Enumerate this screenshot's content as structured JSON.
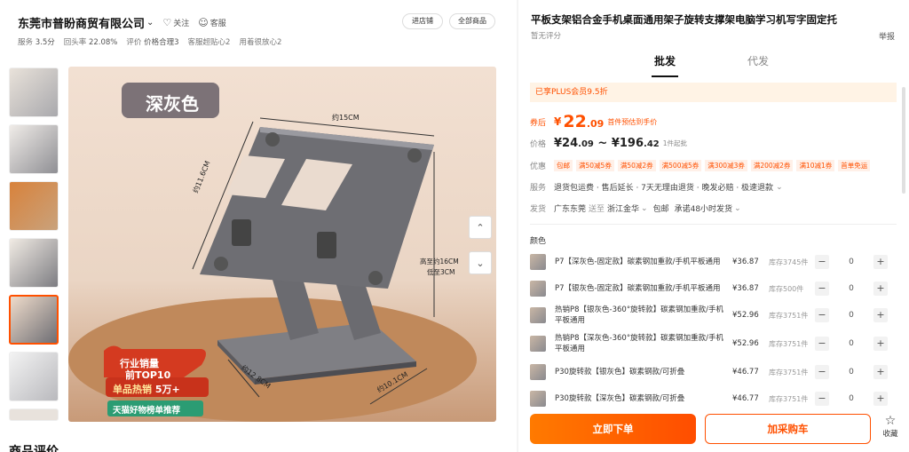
{
  "shop": {
    "name": "东莞市普盼商贸有限公司",
    "follow_label": "关注",
    "service_label": "客服",
    "enter_shop_label": "进店铺",
    "all_products_label": "全部商品",
    "stats": [
      {
        "label": "服务",
        "value": "3.5分"
      },
      {
        "label": "回头率",
        "value": "22.08%"
      },
      {
        "label": "评价",
        "value": "价格合理3"
      },
      {
        "label": "",
        "value": "客服超贴心2"
      },
      {
        "label": "",
        "value": "用着很放心2"
      }
    ]
  },
  "gallery": {
    "selected_index": 4,
    "main_image_labels": {
      "color_tag": "深灰色",
      "width": "约15CM",
      "depth": "约11.6CM",
      "height_max": "高至约16CM",
      "height_min": "低至3CM",
      "base_length": "约12.8CM",
      "base_width": "约10.1CM",
      "badge_line1": "行业销量",
      "badge_line2": "前TOP10",
      "hot_label": "单品热销",
      "hot_count": "5万+",
      "recommend": "天猫好物榜单推荐"
    }
  },
  "section_bottom_title": "商品评价",
  "product": {
    "title": "平板支架铝合金手机桌面通用架子旋转支撑架电脑学习机写字固定托",
    "rating": "暂无评分",
    "report_label": "举报",
    "tabs": [
      "批发",
      "代发"
    ],
    "plus_notice": "已享PLUS会员9.5折",
    "after_coupon_label": "券后",
    "after_price_int": "22",
    "after_price_dec": ".09",
    "after_price_note": "首件预估到手价",
    "price_label": "价格",
    "price_low_int": "24",
    "price_low_dec": ".09",
    "price_high_int": "196",
    "price_high_dec": ".42",
    "price_sep": "~",
    "min_order": "1件起批",
    "promo_label": "优惠",
    "coupons": [
      "包邮",
      "满50减5券",
      "满50减2券",
      "满500减5券",
      "满300减3券",
      "满200减2券",
      "满10减1券",
      "首单免运"
    ],
    "service_label": "服务",
    "services": "退货包运费 · 售后延长 · 7天无理由退货 · 晚发必赔 · 极速退款",
    "ship_label": "发货",
    "ship_from": "广东东莞",
    "ship_to_word": "送至",
    "ship_to": "浙江金华",
    "ship_free": "包邮",
    "ship_promise": "承诺48小时发货",
    "color_section": "颜色",
    "skus": [
      {
        "name": "P7【深灰色-固定款】碳素钢加重款/手机平板通用",
        "price": "¥36.87",
        "stock": "库存3745件",
        "qty": "0"
      },
      {
        "name": "P7【银灰色-固定款】碳素钢加重款/手机平板通用",
        "price": "¥36.87",
        "stock": "库存500件",
        "qty": "0"
      },
      {
        "name": "热销P8【银灰色-360°旋转款】碳素钢加重款/手机平板通用",
        "price": "¥52.96",
        "stock": "库存3751件",
        "qty": "0"
      },
      {
        "name": "热销P8【深灰色-360°旋转款】碳素钢加重款/手机平板通用",
        "price": "¥52.96",
        "stock": "库存3751件",
        "qty": "0"
      },
      {
        "name": "P30旋转款【银灰色】碳素钢款/可折叠",
        "price": "¥46.77",
        "stock": "库存3751件",
        "qty": "0"
      },
      {
        "name": "P30旋转款【深灰色】碳素钢款/可折叠",
        "price": "¥46.77",
        "stock": "库存3751件",
        "qty": "0"
      }
    ],
    "buy_now_label": "立即下单",
    "add_cart_label": "加采购车",
    "favorite_label": "收藏"
  },
  "colors": {
    "accent": "#ff5000",
    "plus_bg": "#fff3e5"
  }
}
